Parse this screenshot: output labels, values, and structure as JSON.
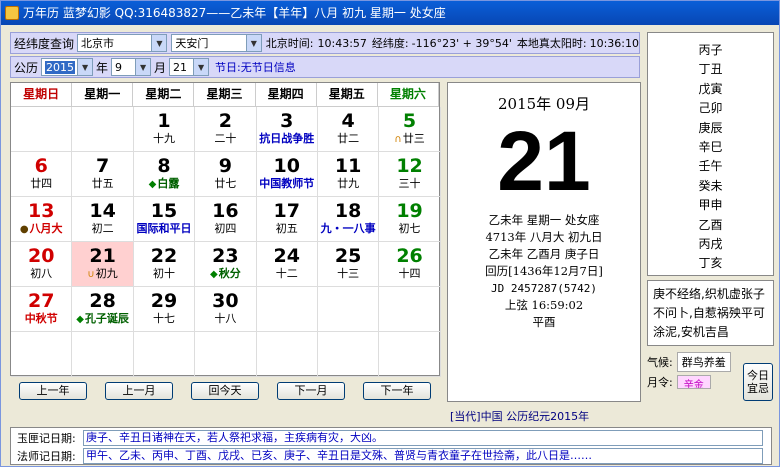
{
  "window": {
    "title": "万年历 蓝梦幻影 QQ:316483827——乙未年【羊年】八月 初九 星期一 处女座"
  },
  "location": {
    "label": "经纬度查询",
    "city": "北京市",
    "district": "天安门",
    "beijing_time_label": "北京时间:",
    "beijing_time": "10:43:57",
    "latlon_label": "经纬度:",
    "latlon": "-116°23' + 39°54'",
    "solar_time_label": "本地真太阳时:",
    "solar_time": "10:36:10"
  },
  "date_row": {
    "calendar_label": "公历",
    "year": "2015",
    "year_label": "年",
    "month": "9",
    "month_label": "月",
    "day": "21",
    "festival_label": "节日:",
    "festival_value": "无节日信息"
  },
  "weekdays": [
    "星期日",
    "星期一",
    "星期二",
    "星期三",
    "星期四",
    "星期五",
    "星期六"
  ],
  "calendar": [
    {
      "day": "",
      "lunar": ""
    },
    {
      "day": "",
      "lunar": ""
    },
    {
      "day": "1",
      "lunar": "十九"
    },
    {
      "day": "2",
      "lunar": "二十"
    },
    {
      "day": "3",
      "lunar": "抗日战争胜",
      "lunar_style": "blue"
    },
    {
      "day": "4",
      "lunar": "廿二"
    },
    {
      "day": "5",
      "lunar": "廿三",
      "mark": "∩",
      "mark_color": "#d08000",
      "day_style": "green"
    },
    {
      "day": "6",
      "lunar": "廿四",
      "day_style": "red"
    },
    {
      "day": "7",
      "lunar": "廿五"
    },
    {
      "day": "8",
      "lunar": "白露",
      "mark": "◆",
      "mark_color": "#008000",
      "lunar_style": "green"
    },
    {
      "day": "9",
      "lunar": "廿七"
    },
    {
      "day": "10",
      "lunar": "中国教师节",
      "lunar_style": "blue"
    },
    {
      "day": "11",
      "lunar": "廿九"
    },
    {
      "day": "12",
      "lunar": "三十",
      "day_style": "green"
    },
    {
      "day": "13",
      "lunar": "八月大",
      "mark": "●",
      "mark_color": "#604000",
      "day_style": "red",
      "lunar_style": "red"
    },
    {
      "day": "14",
      "lunar": "初二"
    },
    {
      "day": "15",
      "lunar": "国际和平日",
      "lunar_style": "blue"
    },
    {
      "day": "16",
      "lunar": "初四"
    },
    {
      "day": "17",
      "lunar": "初五"
    },
    {
      "day": "18",
      "lunar": "九・一八事",
      "lunar_style": "blue"
    },
    {
      "day": "19",
      "lunar": "初七",
      "day_style": "green"
    },
    {
      "day": "20",
      "lunar": "初八",
      "day_style": "red"
    },
    {
      "day": "21",
      "lunar": "初九",
      "mark": "∪",
      "mark_color": "#d08000",
      "today": true
    },
    {
      "day": "22",
      "lunar": "初十"
    },
    {
      "day": "23",
      "lunar": "秋分",
      "mark": "◆",
      "mark_color": "#008000",
      "lunar_style": "green"
    },
    {
      "day": "24",
      "lunar": "十二"
    },
    {
      "day": "25",
      "lunar": "十三"
    },
    {
      "day": "26",
      "lunar": "十四",
      "day_style": "green"
    },
    {
      "day": "27",
      "lunar": "中秋节",
      "day_style": "red",
      "lunar_style": "red"
    },
    {
      "day": "28",
      "lunar": "孔子诞辰",
      "mark": "◆",
      "mark_color": "#008000",
      "lunar_style": "green"
    },
    {
      "day": "29",
      "lunar": "十七"
    },
    {
      "day": "30",
      "lunar": "十八"
    },
    {
      "day": "",
      "lunar": ""
    },
    {
      "day": "",
      "lunar": ""
    },
    {
      "day": "",
      "lunar": ""
    },
    {
      "day": "",
      "lunar": ""
    },
    {
      "day": "",
      "lunar": ""
    },
    {
      "day": "",
      "lunar": ""
    },
    {
      "day": "",
      "lunar": ""
    },
    {
      "day": "",
      "lunar": ""
    },
    {
      "day": "",
      "lunar": ""
    },
    {
      "day": "",
      "lunar": ""
    }
  ],
  "nav": {
    "prev_year": "上一年",
    "prev_month": "上一月",
    "today": "回今天",
    "next_month": "下一月",
    "next_year": "下一年"
  },
  "detail": {
    "year_month": "2015年  09月",
    "big_day": "21",
    "line1": "乙未年 星期一 处女座",
    "line2": "4713年 八月大 初九日",
    "line3": "乙未年 乙酉月 庚子日",
    "line4": "回历[1436年12月7日]",
    "line5": "JD 2457287(5742)",
    "line6": "上弦  16:59:02",
    "line7": "平酉",
    "era": "[当代]中国  公历纪元2015年"
  },
  "ganzhi": [
    "丙子",
    "丁丑",
    "戊寅",
    "己卯",
    "庚辰",
    "辛巳",
    "壬午",
    "癸未",
    "甲申",
    "乙酉",
    "丙戌",
    "丁亥"
  ],
  "yi": {
    "text": "庚不经络,织机虚张子不问卜,自惹祸殃平可涂泥,安机吉昌"
  },
  "qi": {
    "label": "气候:",
    "value": "群鸟养羞"
  },
  "hui": {
    "label": "月令:",
    "value": "辛金"
  },
  "today_button": "今日宜忌",
  "notes": {
    "yuxia_label": "玉匣记日期:",
    "yuxia_text": "庚子、辛丑日诸神在天，若人祭祀求福，主疾病有灾，大凶。",
    "fashi_label": "法师记日期:",
    "fashi_text": "甲午、乙未、丙申、丁酉、戊戌、已亥、庚子、辛丑日是文殊、普贤与青衣童子在世捡斋，此八日是……"
  }
}
